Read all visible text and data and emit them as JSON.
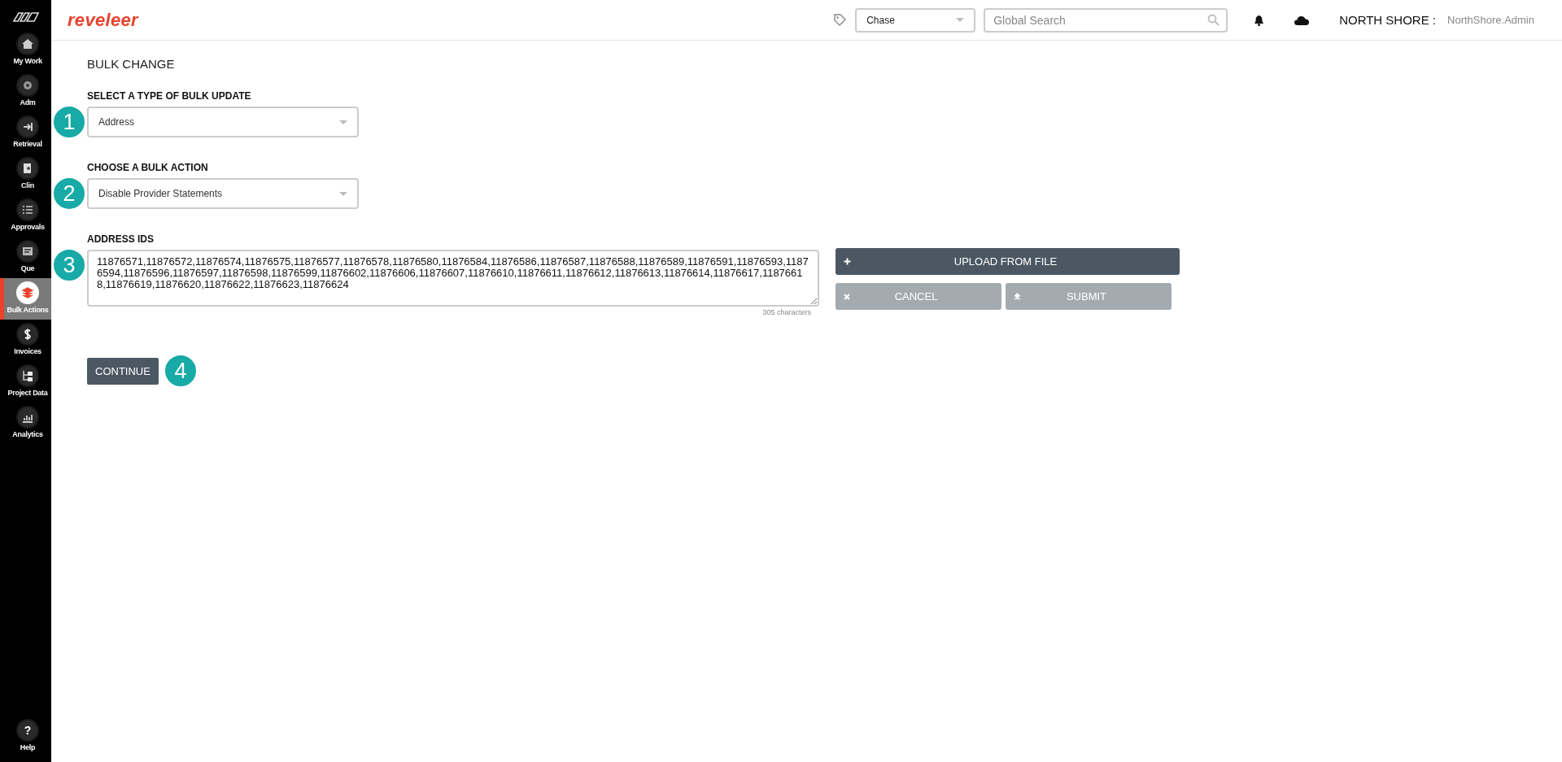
{
  "sidebar": {
    "items": [
      {
        "label": "My Work",
        "selected": false
      },
      {
        "label": "Adm",
        "selected": false
      },
      {
        "label": "Retrieval",
        "selected": false
      },
      {
        "label": "Clin",
        "selected": false
      },
      {
        "label": "Approvals",
        "selected": false
      },
      {
        "label": "Que",
        "selected": false
      },
      {
        "label": "Bulk Actions",
        "selected": true
      },
      {
        "label": "Invoices",
        "selected": false
      },
      {
        "label": "Project Data",
        "selected": false
      },
      {
        "label": "Analytics",
        "selected": false
      }
    ],
    "help": {
      "icon": "?",
      "label": "Help"
    }
  },
  "header": {
    "logo": "reveleer",
    "project_select": "Chase",
    "search": {
      "placeholder": "Global Search"
    },
    "org": "NORTH SHORE :",
    "user": "NorthShore.Admin"
  },
  "page": {
    "title": "BULK CHANGE",
    "update_type": {
      "label": "SELECT A TYPE OF BULK UPDATE",
      "value": "Address",
      "step": "1"
    },
    "bulk_action": {
      "label": "CHOOSE A BULK ACTION",
      "value": "Disable Provider Statements",
      "step": "2"
    },
    "ids": {
      "label": "ADDRESS IDS",
      "value": "11876571,11876572,11876574,11876575,11876577,11876578,11876580,11876584,11876586,11876587,11876588,11876589,11876591,11876593,11876594,11876596,11876597,11876598,11876599,11876602,11876606,11876607,11876610,11876611,11876612,11876613,11876614,11876617,11876618,11876619,11876620,11876622,11876623,11876624",
      "count": "305 characters",
      "step": "3"
    },
    "buttons": [
      {
        "label": "UPLOAD FROM FILE",
        "kind": "upload",
        "disabled": false
      },
      {
        "label": "CANCEL",
        "kind": "cancel",
        "disabled": true
      },
      {
        "label": "SUBMIT",
        "kind": "submit",
        "disabled": true
      }
    ],
    "continue": {
      "label": "CONTINUE",
      "step": "4"
    }
  }
}
